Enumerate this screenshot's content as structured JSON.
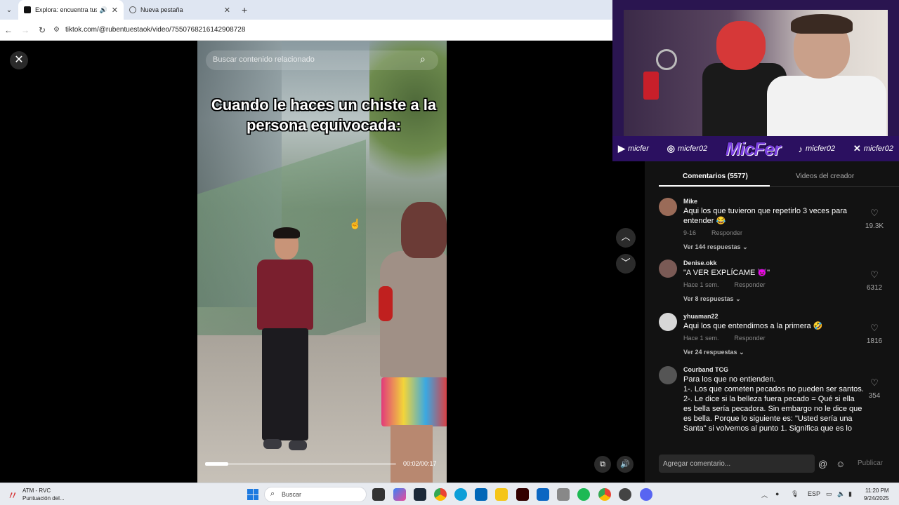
{
  "browser": {
    "tabs": [
      {
        "label": "Explora: encuentra tus vide",
        "active": true,
        "audio": true
      },
      {
        "label": "Nueva pestaña",
        "active": false
      }
    ],
    "url": "tiktok.com/@rubentuestaok/video/7550768216142908728"
  },
  "video": {
    "search_placeholder": "Buscar contenido relacionado",
    "caption": "Cuando le haces un chiste a la persona equivocada:",
    "time": "00:02/00:17",
    "progress": 0.12
  },
  "stream_overlay": {
    "youtube": "micfer",
    "instagram": "micfer02",
    "logo": "MicFer",
    "tiktok": "micfer02",
    "x": "micfer02"
  },
  "comments_panel": {
    "tabs": [
      "Comentarios (5577)",
      "Videos del creador"
    ],
    "reply_label": "Responder",
    "comments": [
      {
        "user": "Mike",
        "text": "Aqui los que tuvieron que repetirlo 3 veces para entender 😂",
        "date": "9-16",
        "replies": "Ver 144 respuestas",
        "likes": "19.3K",
        "avatar_color": "#9a6b58"
      },
      {
        "user": "Denise.okk",
        "text": "\"A VER EXPLÍCAME 👿\"",
        "date": "Hace 1 sem.",
        "replies": "Ver 8 respuestas",
        "likes": "6312",
        "avatar_color": "#7a5a55"
      },
      {
        "user": "yhuaman22",
        "text": "Aqui los que entendimos a la primera 🤣",
        "date": "Hace 1 sem.",
        "replies": "Ver 24 respuestas",
        "likes": "1816",
        "avatar_color": "#d8d8d8"
      },
      {
        "user": "Courband TCG",
        "text": "Para los que no entienden.\n1-. Los que cometen pecados no pueden ser santos.\n2-. Le dice si la belleza fuera pecado = Qué si ella es bella sería pecadora. Sin embargo no le dice que es bella. Porque lo siguiente es: \"Usted sería una Santa\" si volvemos al punto 1. Significa que es lo",
        "likes": "354",
        "avatar_color": "#555"
      }
    ],
    "input_placeholder": "Agregar comentario...",
    "publish": "Publicar"
  },
  "taskbar": {
    "weather_title": "ATM - RVC",
    "weather_sub": "Puntuación del...",
    "search": "Buscar",
    "lang": "ESP",
    "time": "11:20 PM",
    "date": "9/24/2025"
  },
  "colors": {
    "accent": "#fe2c55",
    "panel_bg": "#121212",
    "overlay_purple": "#2b1060"
  }
}
